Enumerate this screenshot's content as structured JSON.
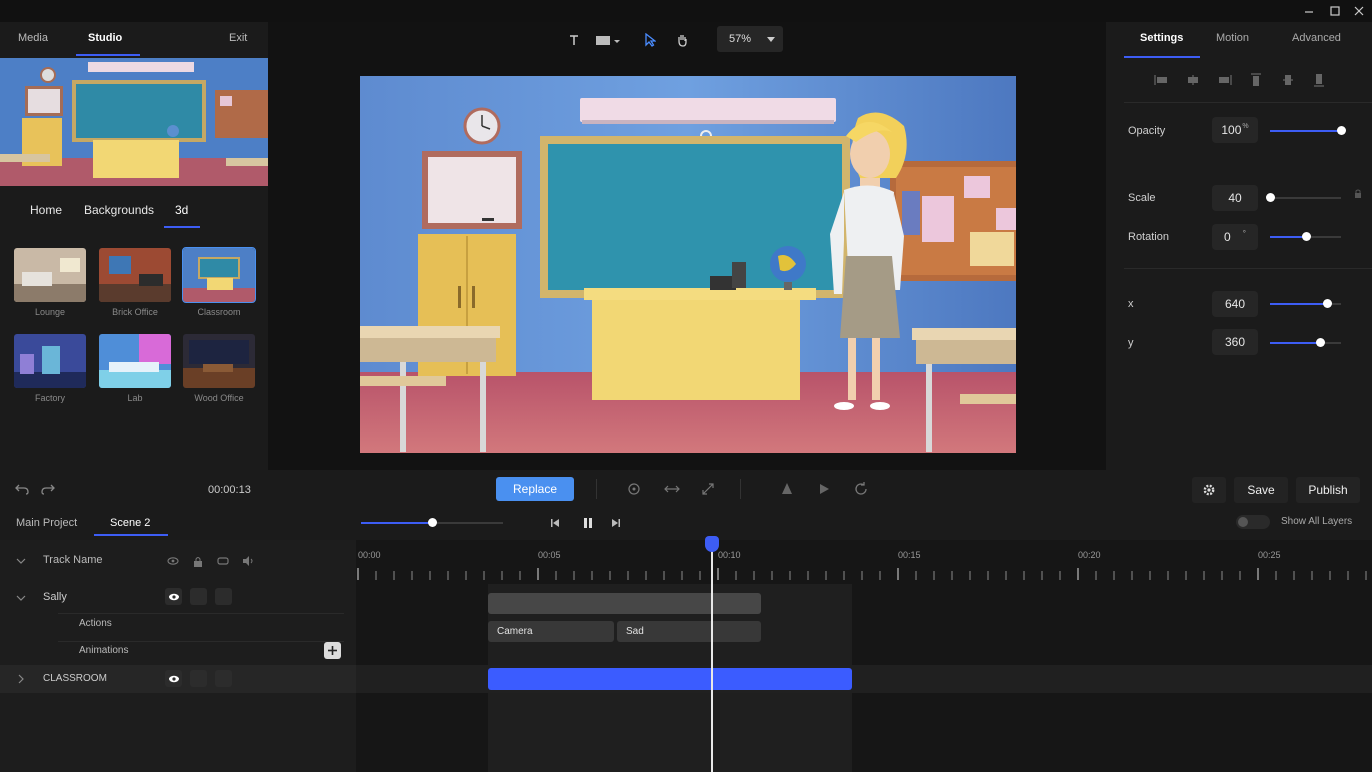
{
  "left_tabs": {
    "media": "Media",
    "studio": "Studio",
    "exit": "Exit"
  },
  "bg_tabs": {
    "home": "Home",
    "backgrounds": "Backgrounds",
    "three_d": "3d"
  },
  "backgrounds": [
    {
      "label": "Lounge"
    },
    {
      "label": "Brick Office"
    },
    {
      "label": "Classroom"
    },
    {
      "label": "Factory"
    },
    {
      "label": "Lab"
    },
    {
      "label": "Wood Office"
    }
  ],
  "canvas_toolbar": {
    "zoom": "57%"
  },
  "right_tabs": {
    "settings": "Settings",
    "motion": "Motion",
    "advanced": "Advanced"
  },
  "properties": {
    "opacity": {
      "label": "Opacity",
      "value": "100",
      "unit": "%",
      "level": 1.0
    },
    "scale": {
      "label": "Scale",
      "value": "40",
      "level": 0.0
    },
    "rotation": {
      "label": "Rotation",
      "value": "0",
      "unit": "°",
      "level": 0.5
    },
    "x": {
      "label": "x",
      "value": "640",
      "level": 0.8
    },
    "y": {
      "label": "y",
      "value": "360",
      "level": 0.7
    }
  },
  "toolbar": {
    "time": "00:00:13",
    "replace": "Replace",
    "save": "Save",
    "publish": "Publish"
  },
  "timeline": {
    "tabs": {
      "main_project": "Main Project",
      "scene2": "Scene 2"
    },
    "show_all_layers": "Show All Layers",
    "ticks": [
      "00:00",
      "00:05",
      "00:10",
      "00:15",
      "00:20",
      "00:25"
    ],
    "tracks": {
      "header": "Track Name",
      "sally": "Sally",
      "actions": "Actions",
      "animations": "Animations",
      "classroom": "CLASSROOM"
    },
    "clips": {
      "camera": "Camera",
      "sad": "Sad"
    }
  },
  "colors": {
    "accent": "#3d5df5",
    "replace_btn": "#4a90f0",
    "clip_blue": "#3b5cff"
  }
}
